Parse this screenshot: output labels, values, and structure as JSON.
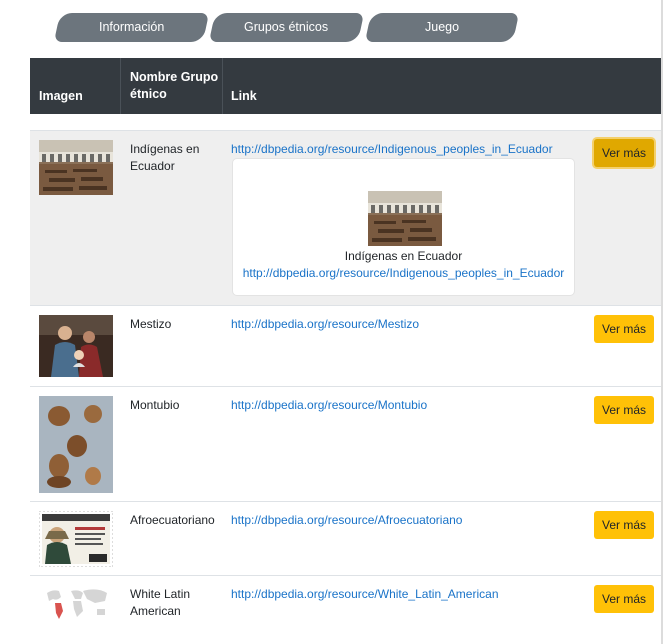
{
  "tabs": [
    {
      "label": "Información"
    },
    {
      "label": "Grupos étnicos"
    },
    {
      "label": "Juego"
    }
  ],
  "table": {
    "headers": {
      "image": "Imagen",
      "name": "Nombre Grupo étnico",
      "link": "Link"
    },
    "rows": [
      {
        "name": "Indígenas en Ecuador",
        "link": "http://dbpedia.org/resource/Indigenous_peoples_in_Ecuador",
        "button": "Ver más",
        "image_icon": "cloister-courtyard-photo"
      },
      {
        "name": "Mestizo",
        "link": "http://dbpedia.org/resource/Mestizo",
        "button": "Ver más",
        "image_icon": "colonial-portrait-painting"
      },
      {
        "name": "Montubio",
        "link": "http://dbpedia.org/resource/Montubio",
        "button": "Ver más",
        "image_icon": "ceramic-vessels-photo"
      },
      {
        "name": "Afroecuatoriano",
        "link": "http://dbpedia.org/resource/Afroecuatoriano",
        "button": "Ver más",
        "image_icon": "postage-stamp",
        "stamp_header": "CORREOS DEL ECUADOR",
        "stamp_value": "2.00"
      },
      {
        "name": "White Latin American",
        "link": "http://dbpedia.org/resource/White_Latin_American",
        "button": "Ver más",
        "image_icon": "world-map"
      }
    ]
  },
  "detail_card": {
    "title": "Indígenas en Ecuador",
    "link": "http://dbpedia.org/resource/Indigenous_peoples_in_Ecuador"
  },
  "colors": {
    "tab_bg": "#6c757d",
    "header_bg": "#343a40",
    "button_bg": "#ffc107",
    "button_active_bg": "#e0a800",
    "link": "#1a73c8"
  }
}
